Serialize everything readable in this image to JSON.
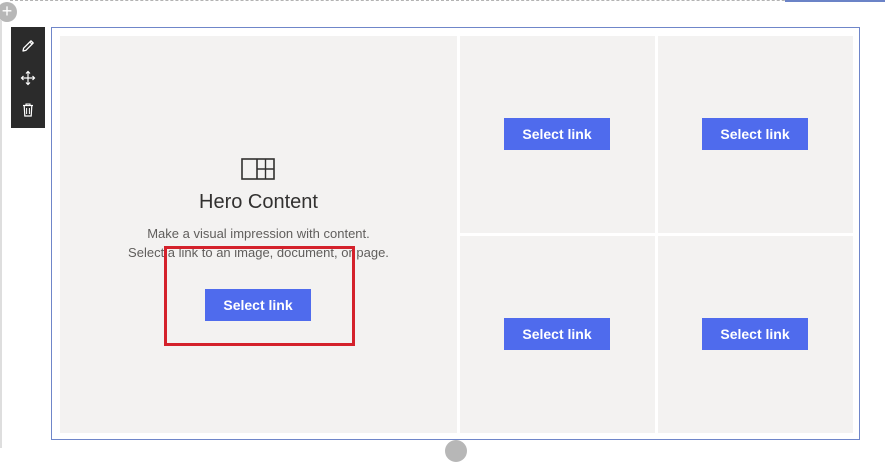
{
  "toolbar": {
    "icons": [
      "edit-icon",
      "move-icon",
      "delete-icon"
    ],
    "background": "#2b2b2b"
  },
  "add_section": {
    "symbol": "+"
  },
  "hero": {
    "icon": "layout-tiles-icon",
    "title": "Hero Content",
    "description_line1": "Make a visual impression with content.",
    "description_line2": "Select a link to an image, document, or page.",
    "button_label": "Select link"
  },
  "tiles": [
    {
      "button_label": "Select link"
    },
    {
      "button_label": "Select link"
    },
    {
      "button_label": "Select link"
    },
    {
      "button_label": "Select link"
    }
  ],
  "colors": {
    "accent": "#4f6bed",
    "tile_background": "#f3f2f1",
    "section_border": "#6f86c9",
    "highlight": "#d4212b"
  }
}
